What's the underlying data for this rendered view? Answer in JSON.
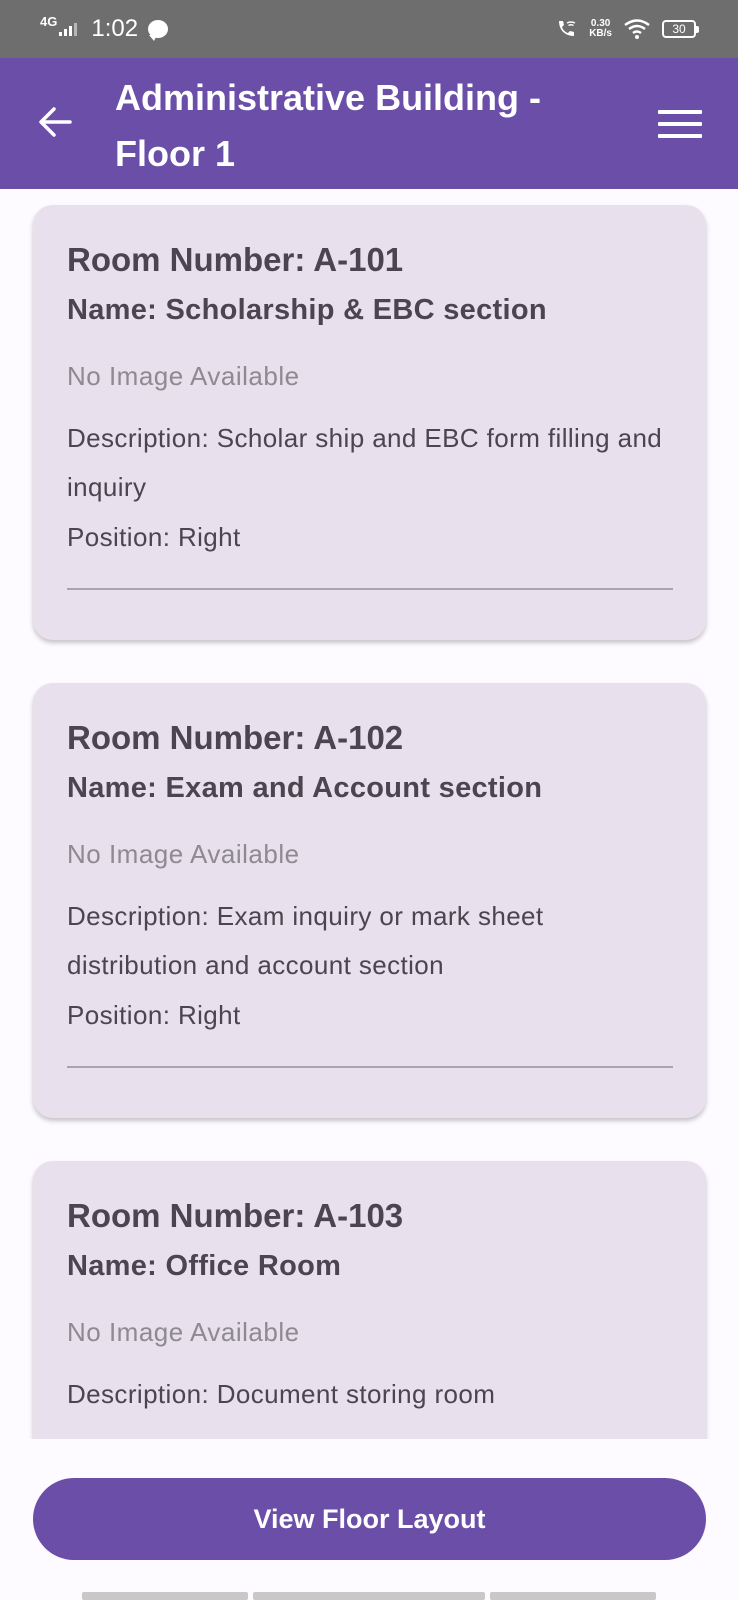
{
  "status_bar": {
    "network": "4G",
    "time": "1:02",
    "speed_value": "0.30",
    "speed_unit": "KB/s",
    "battery": "30"
  },
  "app_bar": {
    "title": "Administrative Building - Floor 1",
    "back_icon": "arrow-left-icon",
    "menu_icon": "hamburger-menu-icon"
  },
  "rooms": [
    {
      "number": "Room Number: A-101",
      "name": "Name: Scholarship & EBC section",
      "image": "No Image Available",
      "description": "Description: Scholar ship and EBC form filling and inquiry",
      "position": "Position: Right"
    },
    {
      "number": "Room Number: A-102",
      "name": "Name: Exam  and Account section",
      "image": "No Image Available",
      "description": "Description: Exam inquiry or mark sheet distribution and account section",
      "position": "Position: Right"
    },
    {
      "number": "Room Number: A-103",
      "name": "Name: Office Room",
      "image": "No Image Available",
      "description": "Description: Document storing room"
    }
  ],
  "footer": {
    "button_label": "View Floor Layout"
  },
  "colors": {
    "primary": "#6a4ea8",
    "card_bg": "#e8e0ec",
    "status_bar": "#6e6e6e"
  }
}
